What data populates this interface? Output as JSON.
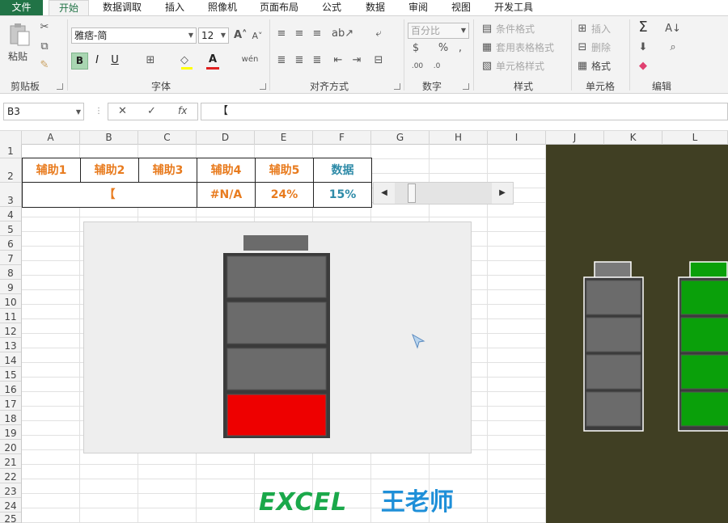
{
  "menu": [
    "文件",
    "开始",
    "数据调取",
    "插入",
    "照像机",
    "页面布局",
    "公式",
    "数据",
    "审阅",
    "视图",
    "开发工具"
  ],
  "ribbon": {
    "clipboard": {
      "label": "剪贴板",
      "paste": "粘贴"
    },
    "font": {
      "label": "字体",
      "name": "雅痞-简",
      "size": "12",
      "bold": "B",
      "italic": "I",
      "underline": "U",
      "color_letter": "A",
      "phonetic": "wén"
    },
    "alignment": {
      "label": "对齐方式"
    },
    "number": {
      "label": "数字",
      "format": "百分比"
    },
    "styles": {
      "label": "样式",
      "conditional": "条件格式",
      "table": "套用表格格式",
      "cell": "单元格样式"
    },
    "cells": {
      "label": "单元格",
      "insert": "插入",
      "delete": "删除",
      "format": "格式"
    },
    "editing": {
      "label": "编辑"
    }
  },
  "formula_bar": {
    "name_box": "B3",
    "cancel": "✕",
    "enter": "✓",
    "fx": "fx",
    "value": "【"
  },
  "columns": [
    "A",
    "B",
    "C",
    "D",
    "E",
    "F",
    "G",
    "H",
    "I",
    "J",
    "K",
    "L"
  ],
  "rows": [
    "1",
    "2",
    "3",
    "4",
    "5",
    "6",
    "7",
    "8",
    "9",
    "10",
    "11",
    "12",
    "13",
    "14",
    "15",
    "16",
    "17",
    "18",
    "19",
    "20",
    "21",
    "22",
    "23",
    "24",
    "25"
  ],
  "table": {
    "headers": [
      "辅助1",
      "辅助2",
      "辅助3",
      "辅助4",
      "辅助5",
      "数据"
    ],
    "row3": {
      "merged_abc": "【",
      "d": "#N/A",
      "e": "24%",
      "f": "15%"
    }
  },
  "scrollbar": {
    "value_fraction": 0.15
  },
  "battery_main": {
    "segments": [
      {
        "color": "#6b6b6b"
      },
      {
        "color": "#6b6b6b"
      },
      {
        "color": "#6b6b6b"
      },
      {
        "color": "#ee0000"
      }
    ]
  },
  "battery_gray": {
    "segments": [
      {
        "color": "#6b6b6b"
      },
      {
        "color": "#6b6b6b"
      },
      {
        "color": "#6b6b6b"
      },
      {
        "color": "#6b6b6b"
      }
    ]
  },
  "battery_green": {
    "segments": [
      {
        "color": "#0aa00a"
      },
      {
        "color": "#0aa00a"
      },
      {
        "color": "#0aa00a"
      },
      {
        "color": "#0aa00a"
      }
    ]
  },
  "colors": {
    "excel_green": "#217346",
    "orange": "#e87b1e",
    "teal": "#2e8ba8",
    "panel": "#403f23"
  },
  "watermark": {
    "excel": "EXCEL",
    "teacher": "王老师"
  }
}
